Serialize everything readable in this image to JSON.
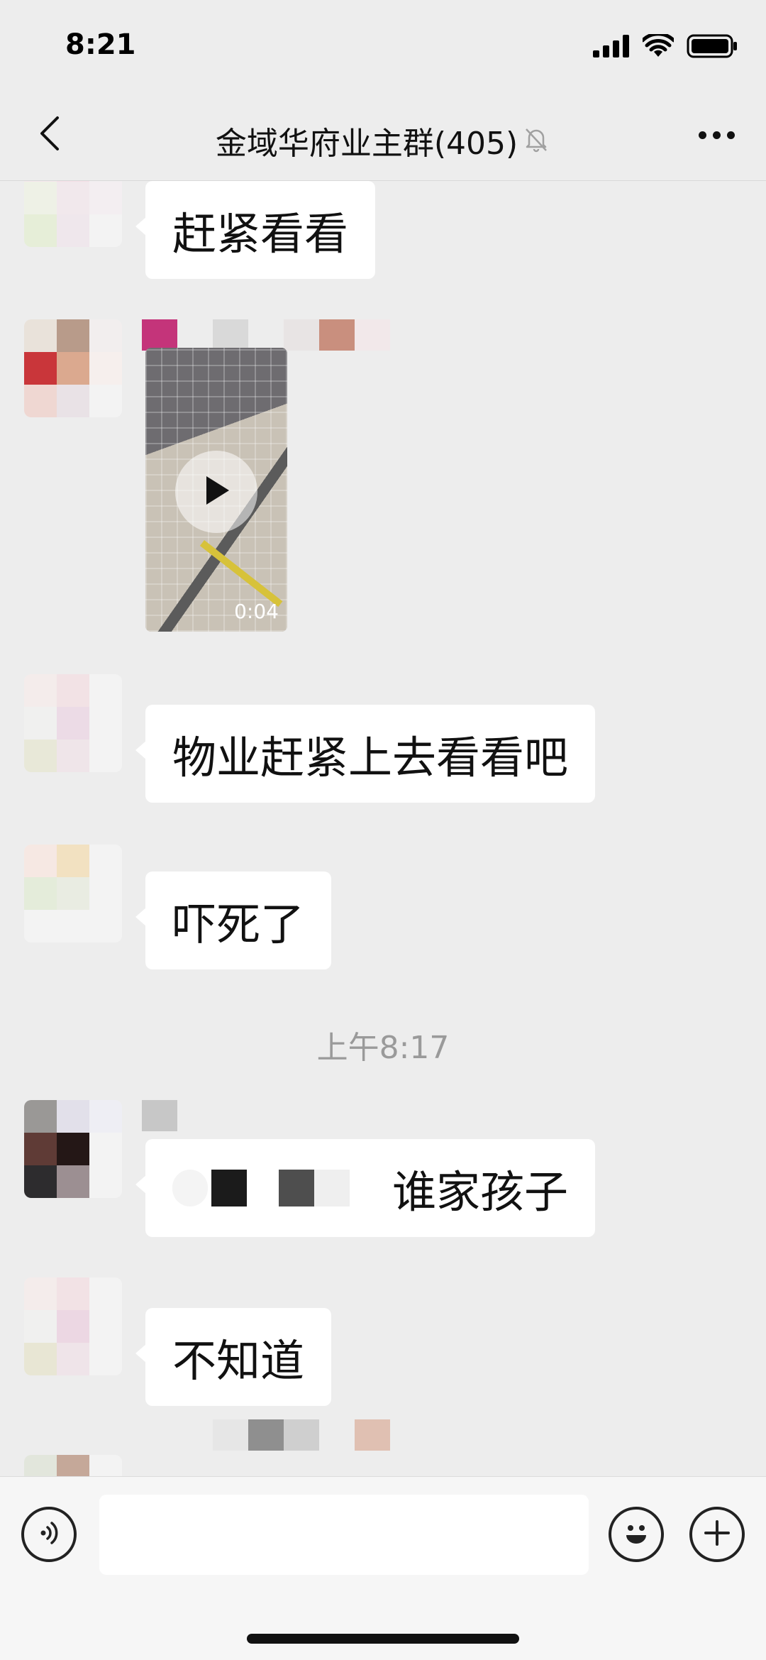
{
  "status_bar": {
    "time": "8:21",
    "icons": [
      "signal-icon",
      "wifi-icon",
      "battery-icon"
    ]
  },
  "nav": {
    "title": "金域华府业主群(405)",
    "icons": [
      "back-icon",
      "mute-bell-icon",
      "more-icon"
    ]
  },
  "messages": [
    {
      "type": "text",
      "text": "赶紧看看"
    },
    {
      "type": "video",
      "duration": "0:04",
      "icon": "play-icon"
    },
    {
      "type": "text",
      "text": "物业赶紧上去看看吧"
    },
    {
      "type": "text",
      "text": "吓死了"
    },
    {
      "type": "timestamp",
      "text": "上午8:17"
    },
    {
      "type": "text",
      "text": "谁家孩子"
    },
    {
      "type": "text",
      "text": "不知道"
    }
  ],
  "input_bar": {
    "placeholder": "",
    "icons": [
      "voice-icon",
      "emoji-icon",
      "plus-icon"
    ]
  },
  "colors": {
    "background": "#ededed",
    "bubble": "#ffffff",
    "text": "#111111",
    "timestamp": "#9a9a9a"
  }
}
